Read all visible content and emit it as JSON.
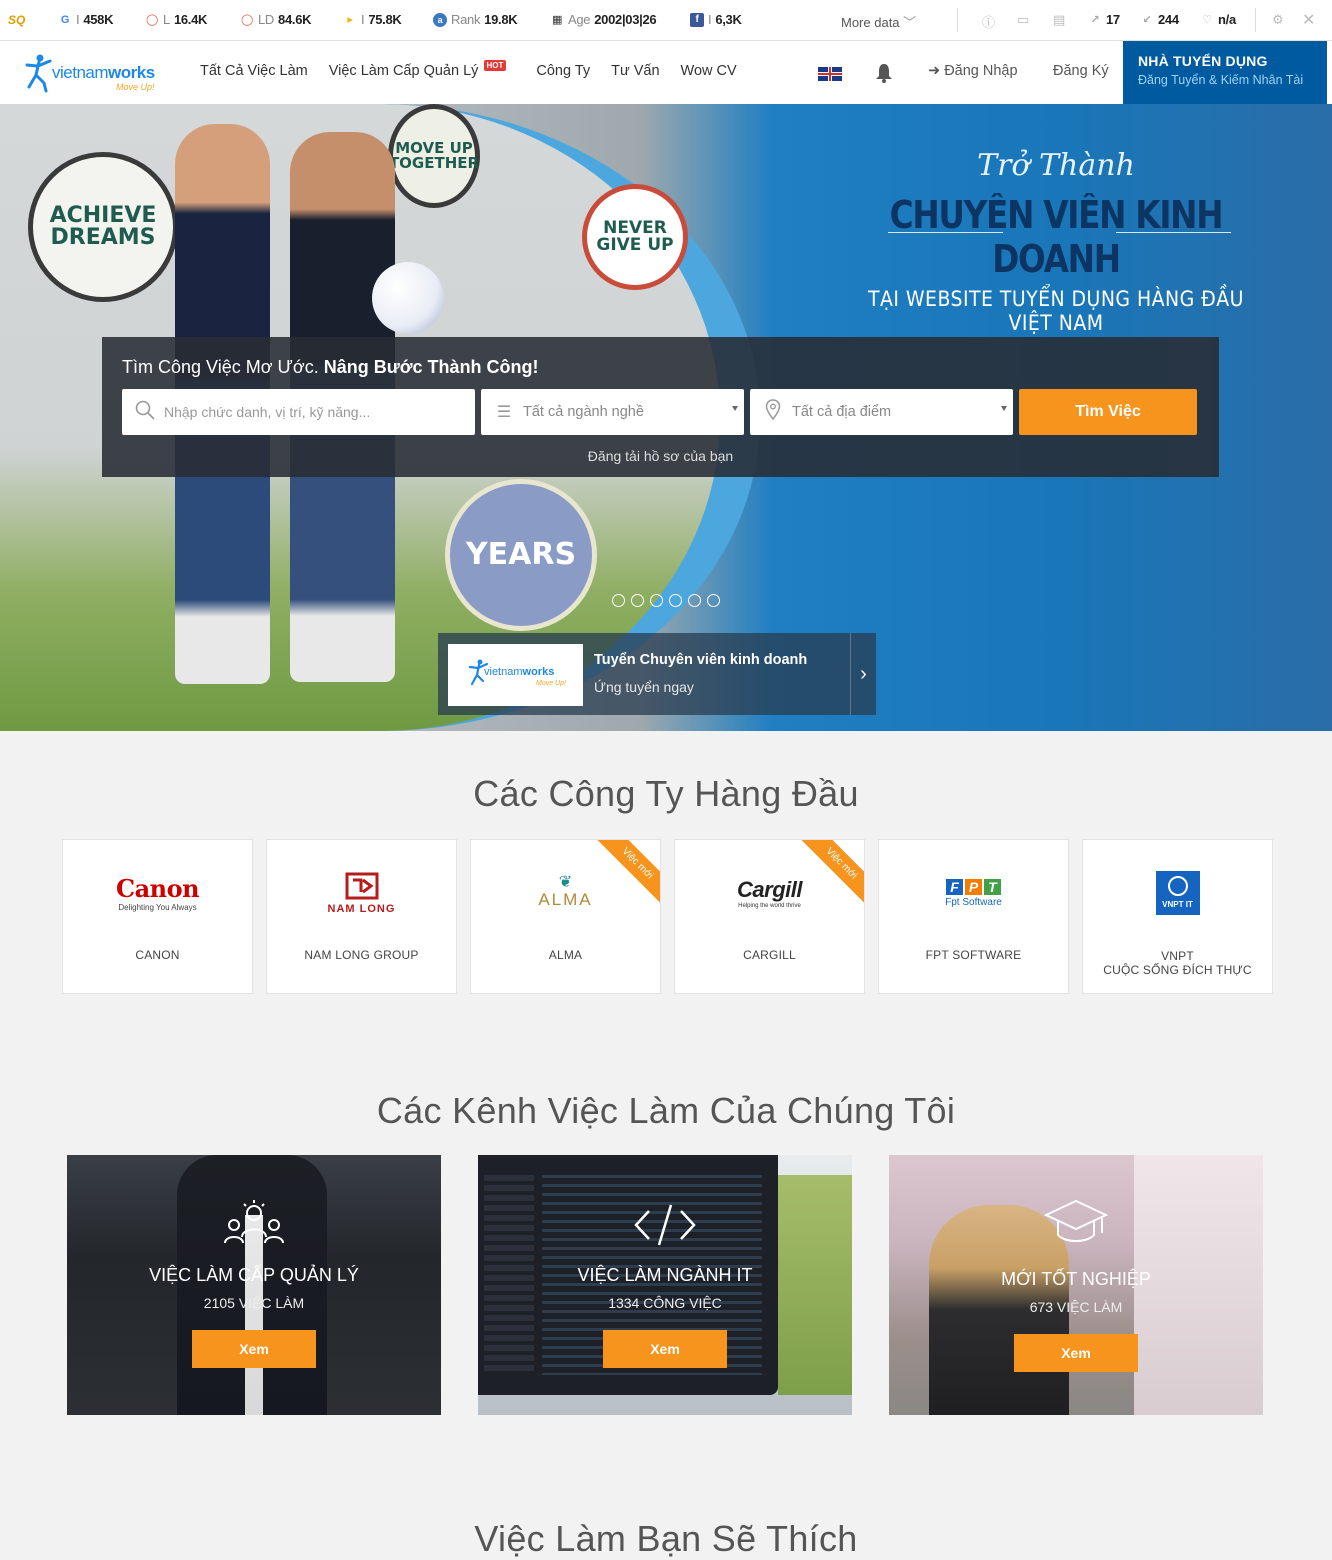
{
  "seo_toolbar": {
    "metrics": [
      {
        "icon": "google-icon",
        "prefix": "I",
        "value": "458K"
      },
      {
        "icon": "links-icon",
        "prefix": "L",
        "value": "16.4K"
      },
      {
        "icon": "linking-domains-icon",
        "prefix": "LD",
        "value": "84.6K"
      },
      {
        "icon": "bing-icon",
        "prefix": "I",
        "value": "75.8K"
      },
      {
        "icon": "rank-icon",
        "prefix": "Rank",
        "value": "19.8K"
      },
      {
        "icon": "age-icon",
        "prefix": "Age",
        "value": "2002|03|26"
      },
      {
        "icon": "facebook-icon",
        "prefix": "I",
        "value": "6,3K"
      }
    ],
    "more_label": "More data",
    "external_links": "17",
    "internal_links": "244",
    "status_value": "n/a"
  },
  "header": {
    "brand_name_light": "vietnam",
    "brand_name_bold": "works",
    "brand_tagline": "Move Up!",
    "nav": [
      {
        "label": "Tất Cả Việc Làm"
      },
      {
        "label": "Việc Làm Cấp Quản Lý",
        "badge": "HOT"
      },
      {
        "label": "Công Ty"
      },
      {
        "label": "Tư Vấn"
      },
      {
        "label": "Wow CV"
      }
    ],
    "login_label": "Đăng Nhập",
    "register_label": "Đăng Ký",
    "employer_title": "NHÀ TUYỂN DỤNG",
    "employer_subtitle": "Đăng Tuyển & Kiếm Nhân Tài"
  },
  "hero": {
    "script_title": "Trở Thành",
    "main_title": "CHUYÊN VIÊN KINH DOANH",
    "sub_title": "TẠI WEBSITE TUYỂN DỤNG HÀNG ĐẦU VIỆT NAM",
    "stickers": [
      "ACHIEVE DREAMS",
      "MOVE UP TOGETHER",
      "NEVER GIVE UP",
      "YEARS"
    ],
    "search": {
      "heading_plain": "Tìm Công Việc Mơ Ước.",
      "heading_bold": "Nâng Bước Thành Công!",
      "keyword_placeholder": "Nhập chức danh, vị trí, kỹ năng...",
      "industry_value": "Tất cả ngành nghề",
      "location_value": "Tất cả địa điểm",
      "button_label": "Tìm Việc",
      "upload_link": "Đăng tải hồ sơ của bạn"
    },
    "slides_total": 6,
    "slides_active": 1,
    "promo": {
      "title": "Tuyển Chuyên viên kinh doanh",
      "subtitle": "Ứng tuyển ngay"
    }
  },
  "top_companies": {
    "title": "Các Công Ty Hàng Đầu",
    "items": [
      {
        "name": "CANON",
        "logo_text": "Canon",
        "logo_sub": "Delighting You Always",
        "ribbon": ""
      },
      {
        "name": "NAM LONG GROUP",
        "logo_text": "NAM LONG",
        "logo_sub": "",
        "ribbon": ""
      },
      {
        "name": "ALMA",
        "logo_text": "ALMA",
        "logo_sub": "",
        "ribbon": "Việc mới"
      },
      {
        "name": "CARGILL",
        "logo_text": "Cargill",
        "logo_sub": "Helping the world thrive",
        "ribbon": "Việc mới"
      },
      {
        "name": "FPT SOFTWARE",
        "logo_text": "FPT",
        "logo_sub": "Fpt Software",
        "ribbon": ""
      },
      {
        "name": "VNPT\nCUỘC SỐNG ĐÍCH THỰC",
        "logo_text": "VNPT IT",
        "logo_sub": "",
        "ribbon": ""
      }
    ]
  },
  "job_channels": {
    "title": "Các Kênh Việc Làm Của Chúng Tôi",
    "items": [
      {
        "title": "VIỆC LÀM CẤP QUẢN LÝ",
        "count": "2105 VIỆC LÀM",
        "button": "Xem",
        "icon": "team-icon"
      },
      {
        "title": "VIỆC LÀM NGÀNH IT",
        "count": "1334 CÔNG VIỆC",
        "button": "Xem",
        "icon": "code-icon"
      },
      {
        "title": "MỚI TỐT NGHIỆP",
        "count": "673 VIỆC LÀM",
        "button": "Xem",
        "icon": "graduation-cap-icon"
      }
    ]
  },
  "recommended": {
    "title": "Việc Làm Bạn Sẽ Thích"
  },
  "colors": {
    "brand_blue": "#1e88e5",
    "employer_bg": "#005aa0",
    "accent_orange": "#f7941d"
  }
}
